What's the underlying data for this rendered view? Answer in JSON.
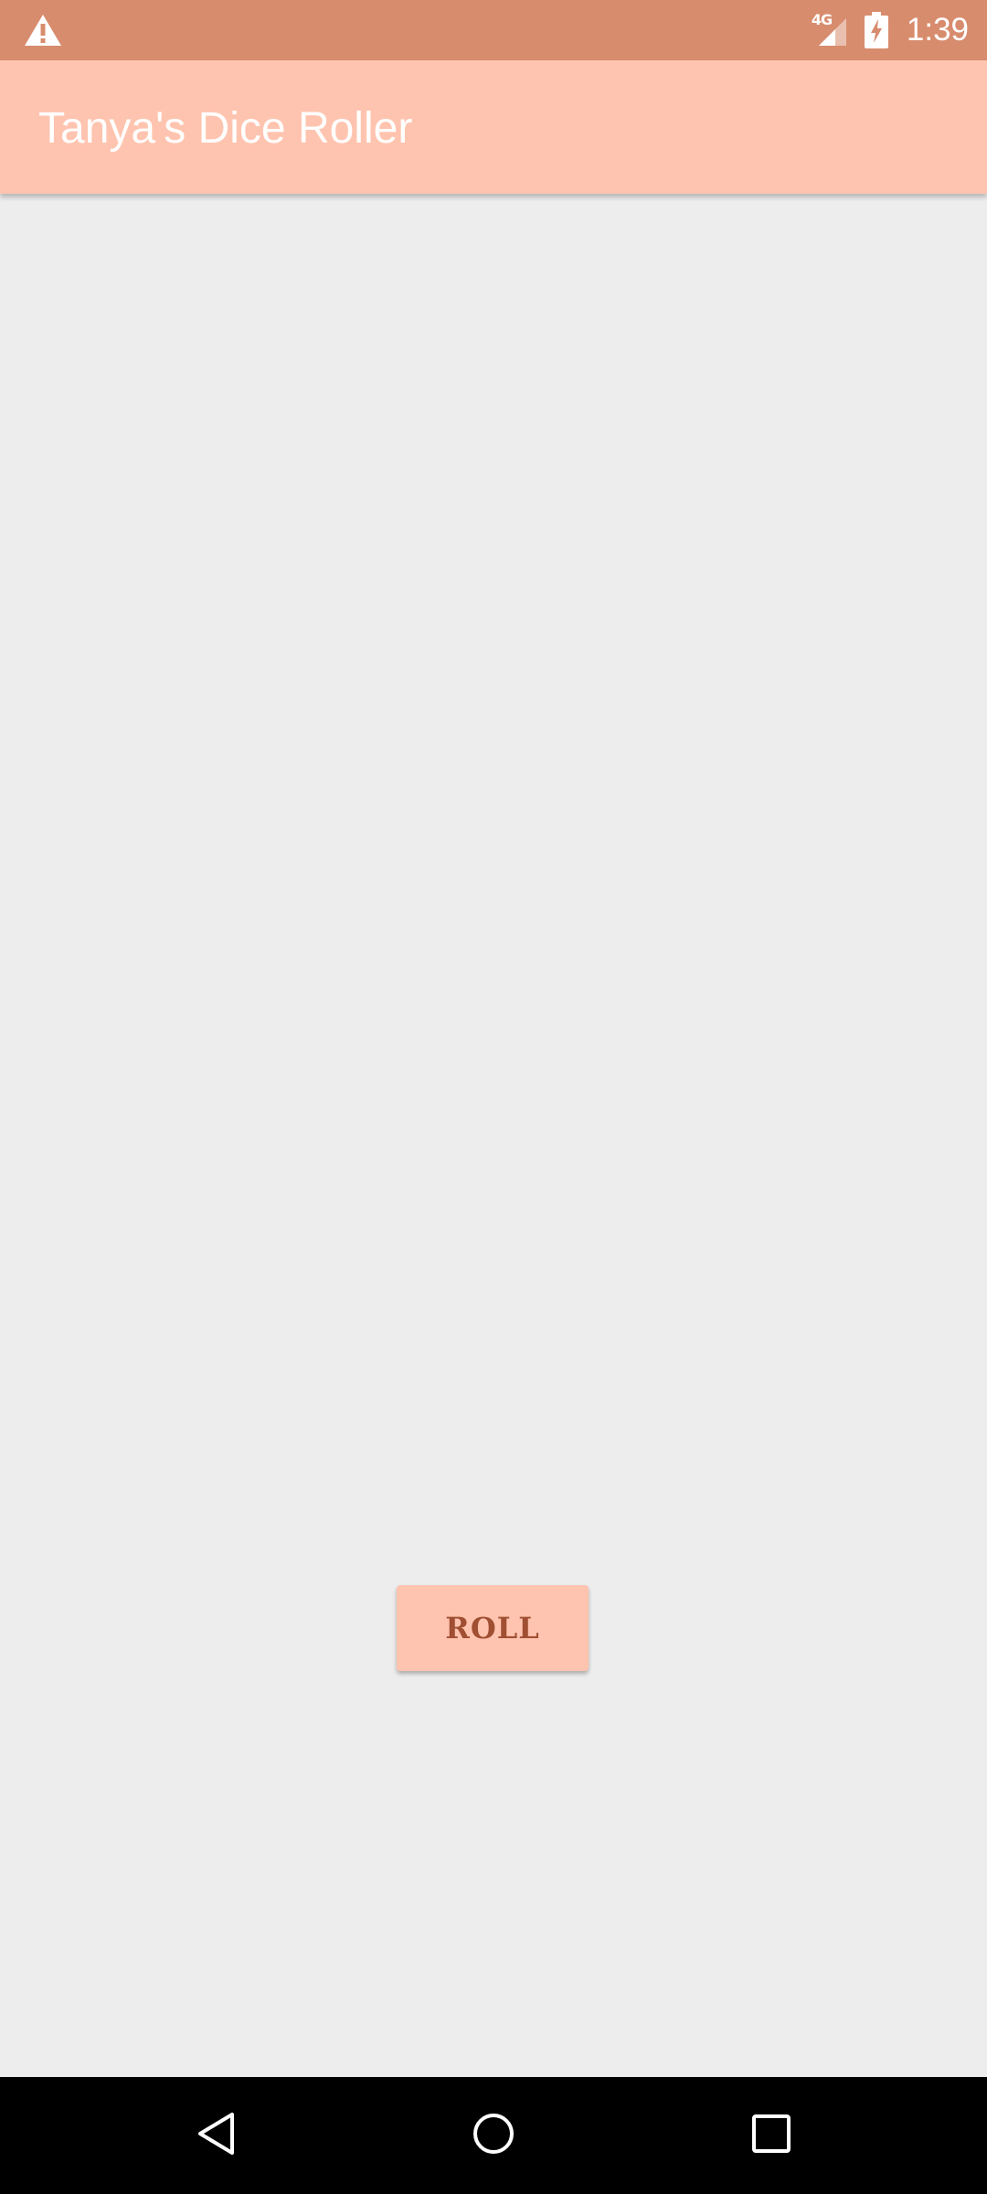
{
  "status_bar": {
    "alert_icon": "warning-icon",
    "network_label": "4G",
    "signal_icon": "cell-signal-icon",
    "battery_icon": "battery-charging-icon",
    "time": "1:39"
  },
  "app_bar": {
    "title": "Tanya's Dice Roller"
  },
  "main": {
    "roll_button_label": "ROLL"
  },
  "nav_bar": {
    "back_icon": "back-triangle-icon",
    "home_icon": "home-circle-icon",
    "recents_icon": "recents-square-icon"
  },
  "colors": {
    "status_bar": "#d88c6e",
    "app_bar": "#ffc4af",
    "background": "#eeeded",
    "button_text": "#a04f33",
    "nav_bar": "#000000"
  }
}
